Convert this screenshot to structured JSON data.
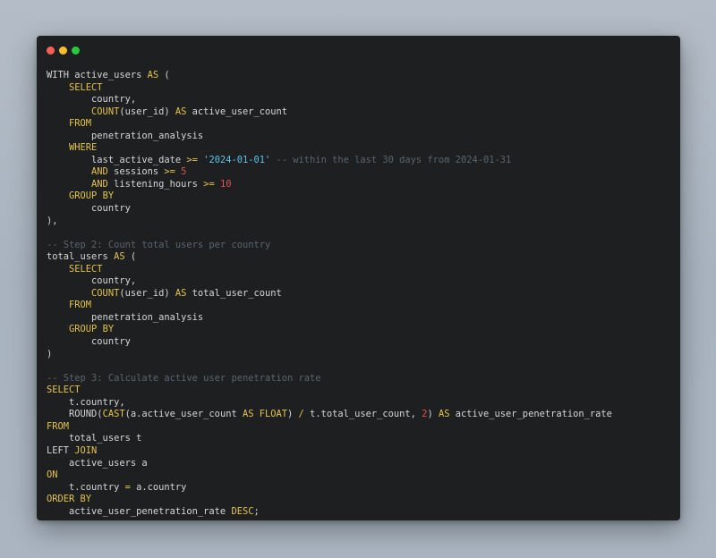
{
  "window": {
    "controls": [
      {
        "name": "close",
        "color": "#ff5f56"
      },
      {
        "name": "minimize",
        "color": "#ffbd2e"
      },
      {
        "name": "maximize",
        "color": "#27c93f"
      }
    ]
  },
  "colors": {
    "keyword": "#e3c44a",
    "string": "#5ec4e8",
    "number": "#e0534f",
    "comment": "#59656f",
    "text": "#d6d6d6",
    "background": "#1e1f21"
  },
  "code_lines": [
    [
      {
        "t": "WITH active_users ",
        "c": "pl"
      },
      {
        "t": "AS",
        "c": "kw"
      },
      {
        "t": " (",
        "c": "pl"
      }
    ],
    [
      {
        "t": "    ",
        "c": "pl"
      },
      {
        "t": "SELECT",
        "c": "kw"
      }
    ],
    [
      {
        "t": "        country,",
        "c": "pl"
      }
    ],
    [
      {
        "t": "        ",
        "c": "pl"
      },
      {
        "t": "COUNT",
        "c": "kw"
      },
      {
        "t": "(user_id) ",
        "c": "pl"
      },
      {
        "t": "AS",
        "c": "kw"
      },
      {
        "t": " active_user_count",
        "c": "pl"
      }
    ],
    [
      {
        "t": "    ",
        "c": "pl"
      },
      {
        "t": "FROM",
        "c": "kw"
      }
    ],
    [
      {
        "t": "        penetration_analysis",
        "c": "pl"
      }
    ],
    [
      {
        "t": "    ",
        "c": "pl"
      },
      {
        "t": "WHERE",
        "c": "kw"
      }
    ],
    [
      {
        "t": "        last_active_date ",
        "c": "pl"
      },
      {
        "t": ">=",
        "c": "op"
      },
      {
        "t": " ",
        "c": "pl"
      },
      {
        "t": "'2024-01-01'",
        "c": "str"
      },
      {
        "t": " -- within the last 30 days from 2024-01-31",
        "c": "cm"
      }
    ],
    [
      {
        "t": "        ",
        "c": "pl"
      },
      {
        "t": "AND",
        "c": "kw"
      },
      {
        "t": " sessions ",
        "c": "pl"
      },
      {
        "t": ">=",
        "c": "op"
      },
      {
        "t": " ",
        "c": "pl"
      },
      {
        "t": "5",
        "c": "num"
      }
    ],
    [
      {
        "t": "        ",
        "c": "pl"
      },
      {
        "t": "AND",
        "c": "kw"
      },
      {
        "t": " listening_hours ",
        "c": "pl"
      },
      {
        "t": ">=",
        "c": "op"
      },
      {
        "t": " ",
        "c": "pl"
      },
      {
        "t": "10",
        "c": "num"
      }
    ],
    [
      {
        "t": "    ",
        "c": "pl"
      },
      {
        "t": "GROUP BY",
        "c": "kw"
      }
    ],
    [
      {
        "t": "        country",
        "c": "pl"
      }
    ],
    [
      {
        "t": "),",
        "c": "pl"
      }
    ],
    [
      {
        "t": "",
        "c": "pl"
      }
    ],
    [
      {
        "t": "-- Step 2: Count total users per country",
        "c": "cm"
      }
    ],
    [
      {
        "t": "total_users ",
        "c": "pl"
      },
      {
        "t": "AS",
        "c": "kw"
      },
      {
        "t": " (",
        "c": "pl"
      }
    ],
    [
      {
        "t": "    ",
        "c": "pl"
      },
      {
        "t": "SELECT",
        "c": "kw"
      }
    ],
    [
      {
        "t": "        country,",
        "c": "pl"
      }
    ],
    [
      {
        "t": "        ",
        "c": "pl"
      },
      {
        "t": "COUNT",
        "c": "kw"
      },
      {
        "t": "(user_id) ",
        "c": "pl"
      },
      {
        "t": "AS",
        "c": "kw"
      },
      {
        "t": " total_user_count",
        "c": "pl"
      }
    ],
    [
      {
        "t": "    ",
        "c": "pl"
      },
      {
        "t": "FROM",
        "c": "kw"
      }
    ],
    [
      {
        "t": "        penetration_analysis",
        "c": "pl"
      }
    ],
    [
      {
        "t": "    ",
        "c": "pl"
      },
      {
        "t": "GROUP BY",
        "c": "kw"
      }
    ],
    [
      {
        "t": "        country",
        "c": "pl"
      }
    ],
    [
      {
        "t": ")",
        "c": "pl"
      }
    ],
    [
      {
        "t": "",
        "c": "pl"
      }
    ],
    [
      {
        "t": "-- Step 3: Calculate active user penetration rate",
        "c": "cm"
      }
    ],
    [
      {
        "t": "SELECT",
        "c": "kw"
      }
    ],
    [
      {
        "t": "    t.country,",
        "c": "pl"
      }
    ],
    [
      {
        "t": "    ROUND(",
        "c": "pl"
      },
      {
        "t": "CAST",
        "c": "kw"
      },
      {
        "t": "(a.active_user_count ",
        "c": "pl"
      },
      {
        "t": "AS",
        "c": "kw"
      },
      {
        "t": " ",
        "c": "pl"
      },
      {
        "t": "FLOAT",
        "c": "kw"
      },
      {
        "t": ") ",
        "c": "pl"
      },
      {
        "t": "/",
        "c": "op"
      },
      {
        "t": " t.total_user_count, ",
        "c": "pl"
      },
      {
        "t": "2",
        "c": "num"
      },
      {
        "t": ") ",
        "c": "pl"
      },
      {
        "t": "AS",
        "c": "kw"
      },
      {
        "t": " active_user_penetration_rate",
        "c": "pl"
      }
    ],
    [
      {
        "t": "FROM",
        "c": "kw"
      }
    ],
    [
      {
        "t": "    total_users t",
        "c": "pl"
      }
    ],
    [
      {
        "t": "LEFT ",
        "c": "pl"
      },
      {
        "t": "JOIN",
        "c": "kw"
      }
    ],
    [
      {
        "t": "    active_users a",
        "c": "pl"
      }
    ],
    [
      {
        "t": "ON",
        "c": "kw"
      }
    ],
    [
      {
        "t": "    t.country ",
        "c": "pl"
      },
      {
        "t": "=",
        "c": "op"
      },
      {
        "t": " a.country",
        "c": "pl"
      }
    ],
    [
      {
        "t": "ORDER BY",
        "c": "kw"
      }
    ],
    [
      {
        "t": "    active_user_penetration_rate ",
        "c": "pl"
      },
      {
        "t": "DESC",
        "c": "kw"
      },
      {
        "t": ";",
        "c": "pl"
      }
    ]
  ]
}
